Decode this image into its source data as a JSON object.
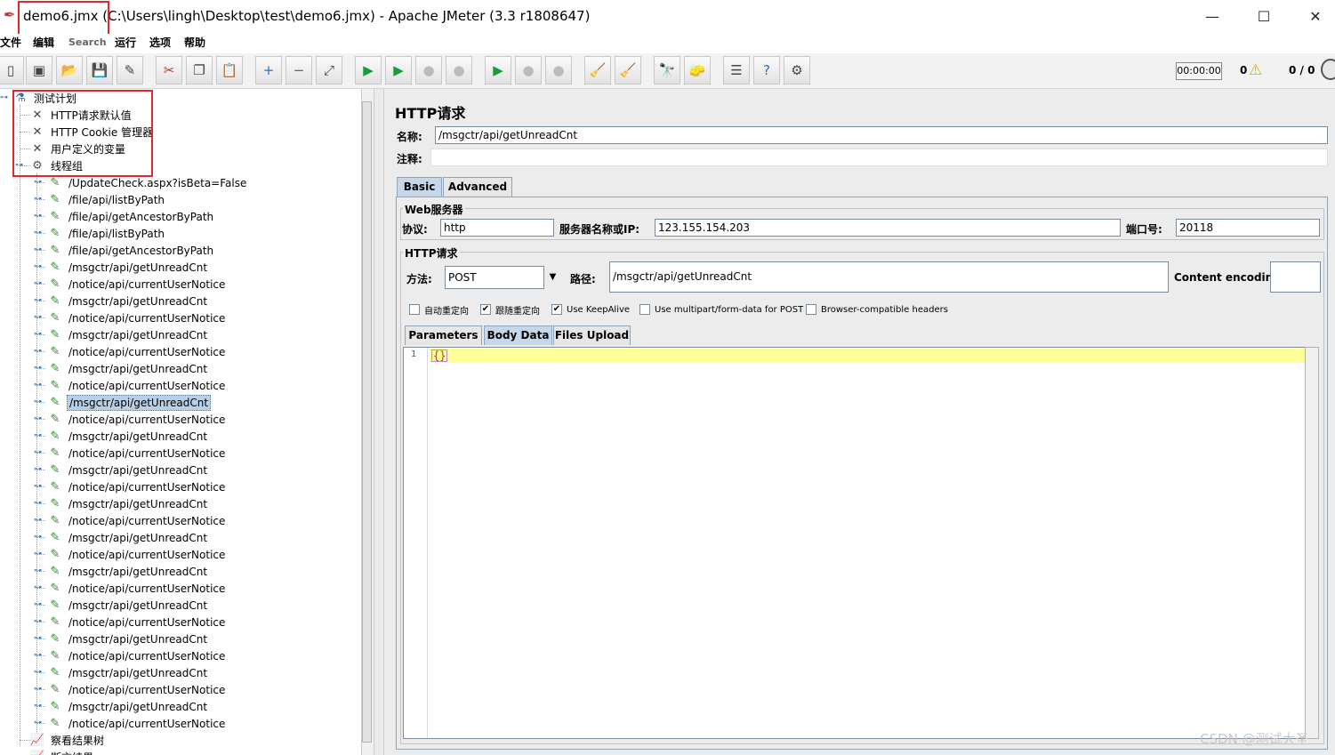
{
  "window": {
    "title": "demo6.jmx (C:\\Users\\lingh\\Desktop\\test\\demo6.jmx) - Apache JMeter (3.3 r1808647)",
    "minimize_glyph": "—",
    "maximize_glyph": "☐",
    "close_glyph": "✕"
  },
  "menu": [
    "文件",
    "编辑",
    "Search",
    "运行",
    "选项",
    "帮助"
  ],
  "toolbar": {
    "icons": [
      "new-icon",
      "templates-icon",
      "open-icon",
      "save-icon",
      "save-as-icon",
      "cut-icon",
      "copy-icon",
      "paste-icon",
      "expand-icon",
      "collapse-icon",
      "toggle-icon",
      "start-icon",
      "start-no-pause-icon",
      "stop-icon",
      "shutdown-icon",
      "remote-start-icon",
      "remote-stop-icon",
      "remote-shutdown-icon",
      "clear-icon",
      "clear-all-icon",
      "search-icon",
      "reset-search-icon",
      "function-helper-icon",
      "help-icon",
      "log-viewer-icon"
    ],
    "timer": "00:00:00",
    "warnings": "0",
    "threads": "0 / 0"
  },
  "tree": {
    "root": "测试计划",
    "config": [
      "HTTP请求默认值",
      "HTTP Cookie 管理器",
      "用户定义的变量"
    ],
    "thread_group": "线程组",
    "samplers": [
      "/UpdateCheck.aspx?isBeta=False",
      "/file/api/listByPath",
      "/file/api/getAncestorByPath",
      "/file/api/listByPath",
      "/file/api/getAncestorByPath",
      "/msgctr/api/getUnreadCnt",
      "/notice/api/currentUserNotice",
      "/msgctr/api/getUnreadCnt",
      "/notice/api/currentUserNotice",
      "/msgctr/api/getUnreadCnt",
      "/notice/api/currentUserNotice",
      "/msgctr/api/getUnreadCnt",
      "/notice/api/currentUserNotice",
      "/msgctr/api/getUnreadCnt",
      "/notice/api/currentUserNotice",
      "/msgctr/api/getUnreadCnt",
      "/notice/api/currentUserNotice",
      "/msgctr/api/getUnreadCnt",
      "/notice/api/currentUserNotice",
      "/msgctr/api/getUnreadCnt",
      "/notice/api/currentUserNotice",
      "/msgctr/api/getUnreadCnt",
      "/notice/api/currentUserNotice",
      "/msgctr/api/getUnreadCnt",
      "/notice/api/currentUserNotice",
      "/msgctr/api/getUnreadCnt",
      "/notice/api/currentUserNotice",
      "/msgctr/api/getUnreadCnt",
      "/notice/api/currentUserNotice",
      "/msgctr/api/getUnreadCnt",
      "/notice/api/currentUserNotice",
      "/msgctr/api/getUnreadCnt",
      "/notice/api/currentUserNotice"
    ],
    "selected_index": 13,
    "listeners": [
      "察看结果树",
      "断言结果"
    ]
  },
  "form": {
    "title": "HTTP请求",
    "name_label": "名称:",
    "name_value": "/msgctr/api/getUnreadCnt",
    "comment_label": "注释:",
    "tabs": [
      "Basic",
      "Advanced"
    ],
    "web_server_group": "Web服务器",
    "protocol_label": "协议:",
    "protocol_value": "http",
    "server_label": "服务器名称或IP:",
    "server_value": "123.155.154.203",
    "port_label": "端口号:",
    "port_value": "20118",
    "http_request_group": "HTTP请求",
    "method_label": "方法:",
    "method_value": "POST",
    "path_label": "路径:",
    "path_value": "/msgctr/api/getUnreadCnt",
    "encoding_label": "Content encoding:",
    "encoding_value": "",
    "checkboxes": [
      {
        "label": "自动重定向",
        "checked": false
      },
      {
        "label": "跟随重定向",
        "checked": true
      },
      {
        "label": "Use KeepAlive",
        "checked": true
      },
      {
        "label": "Use multipart/form-data for POST",
        "checked": false
      },
      {
        "label": "Browser-compatible headers",
        "checked": false
      }
    ],
    "body_tabs": [
      "Parameters",
      "Body Data",
      "Files Upload"
    ],
    "editor_line": "1",
    "editor_text": "{}"
  },
  "watermark": "CSDN @测试大圣"
}
